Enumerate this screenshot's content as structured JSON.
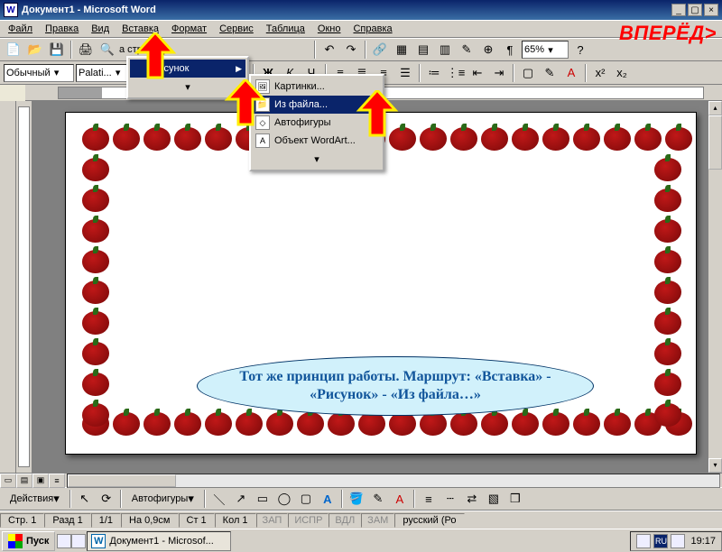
{
  "window": {
    "title": "Документ1 - Microsoft Word"
  },
  "menu": {
    "items": [
      "Файл",
      "Правка",
      "Вид",
      "Вставка",
      "Формат",
      "Сервис",
      "Таблица",
      "Окно",
      "Справка"
    ]
  },
  "nav_label": "ВПЕРЁД>",
  "toolbar1": {
    "page_label": "а страниц...",
    "zoom": "65%"
  },
  "format": {
    "style": "Обычный",
    "font": "Palati..."
  },
  "fmt_btns": {
    "bold": "Ж",
    "italic": "К",
    "underline": "Ч"
  },
  "insert_menu": {
    "selected": "Рисунок"
  },
  "picture_submenu": {
    "items": [
      {
        "label": "Картинки...",
        "icon": "🖼"
      },
      {
        "label": "Из файла...",
        "icon": "📁",
        "selected": true
      },
      {
        "label": "Автофигуры",
        "icon": "◇"
      },
      {
        "label": "Объект WordArt...",
        "icon": "A"
      }
    ]
  },
  "callout_text": "Тот же принцип работы. Маршрут: «Вставка» - «Рисунок» - «Из файла…»",
  "draw": {
    "actions": "Действия",
    "autoshapes": "Автофигуры"
  },
  "status": {
    "page": "Стр. 1",
    "sect": "Разд 1",
    "frac": "1/1",
    "at": "На 0,9см",
    "line": "Ст 1",
    "col": "Кол 1",
    "rec": "ЗАП",
    "trk": "ИСПР",
    "ext": "ВДЛ",
    "ovr": "ЗАМ",
    "lang": "русский (Ро"
  },
  "taskbar": {
    "start": "Пуск",
    "app": "Документ1 - Microsof...",
    "lang": "RU",
    "clock": "19:17"
  }
}
